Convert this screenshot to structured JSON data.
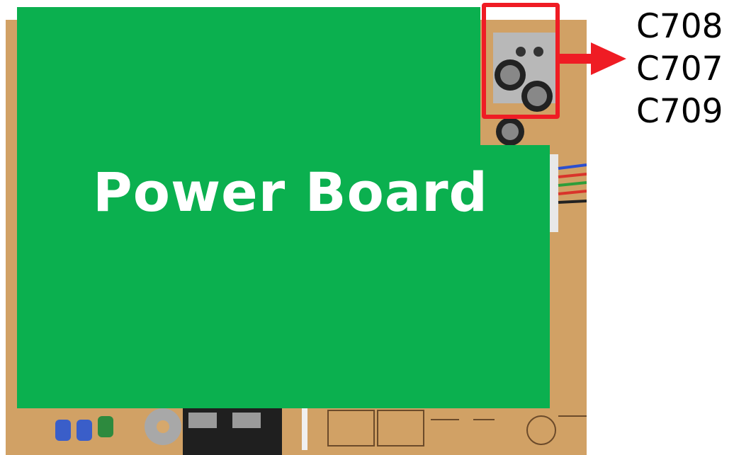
{
  "overlay": {
    "title": "Power Board",
    "color": "#0bb04f"
  },
  "highlight": {
    "color": "#ef1c24"
  },
  "capacitors": [
    "C708",
    "C707",
    "C709"
  ]
}
